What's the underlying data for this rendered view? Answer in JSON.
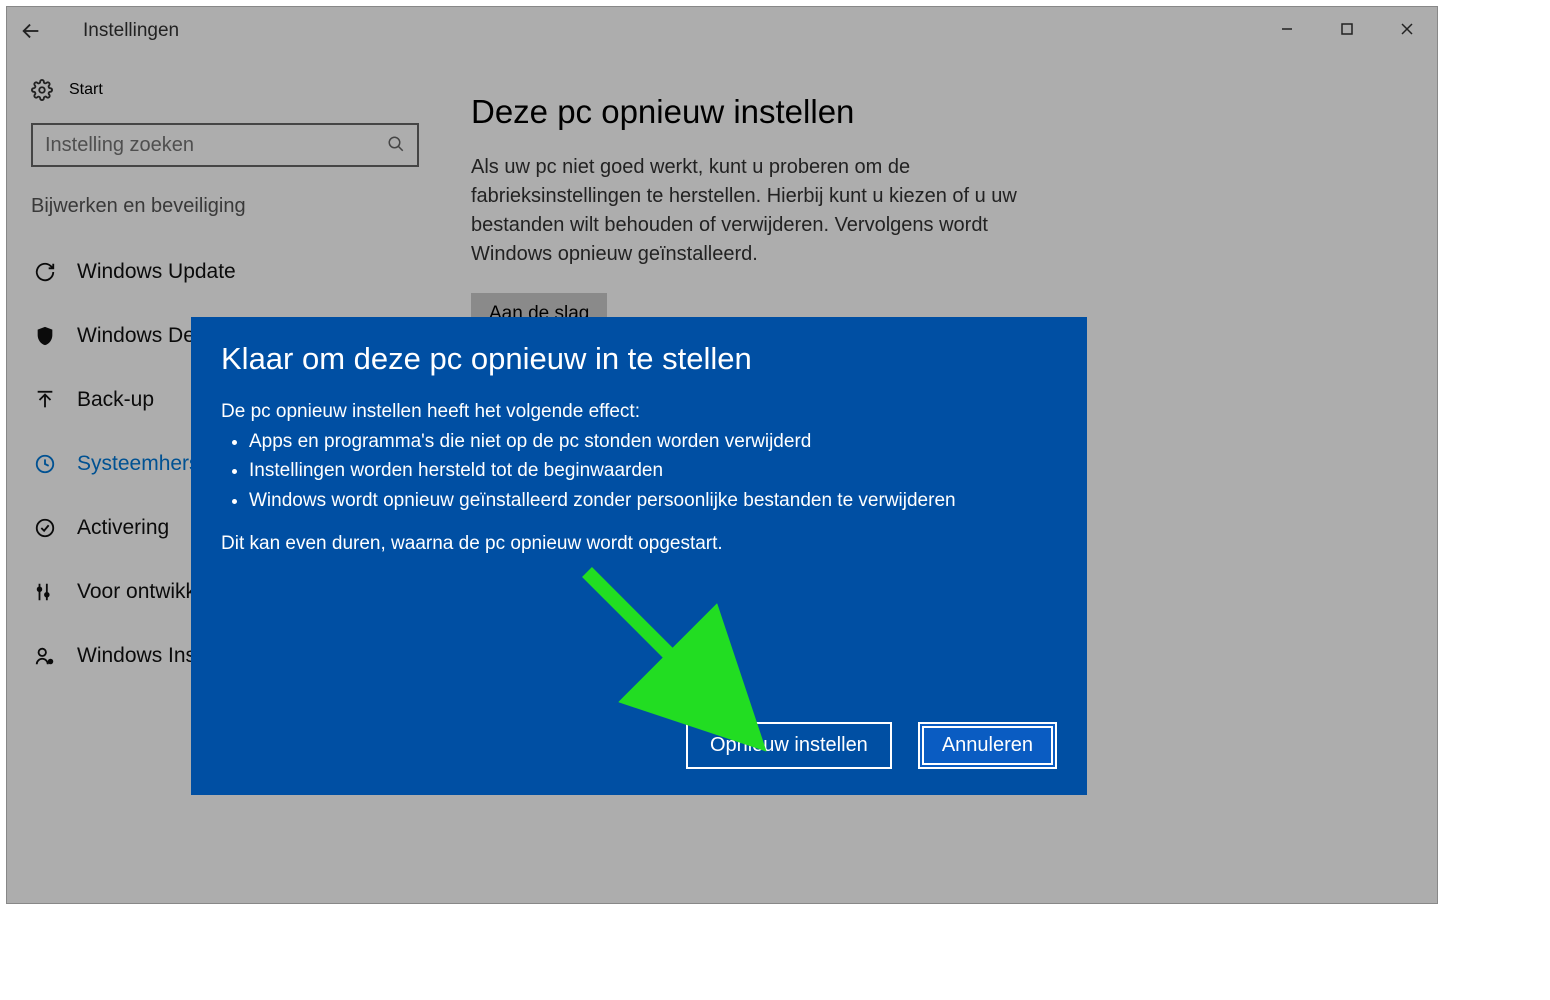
{
  "window": {
    "title": "Instellingen"
  },
  "sidebar": {
    "start_label": "Start",
    "search_placeholder": "Instelling zoeken",
    "section_label": "Bijwerken en beveiliging",
    "items": [
      {
        "label": "Windows Update",
        "icon": "sync-icon",
        "active": false
      },
      {
        "label": "Windows Defender",
        "icon": "shield-icon",
        "active": false
      },
      {
        "label": "Back-up",
        "icon": "upload-icon",
        "active": false
      },
      {
        "label": "Systeemherstel",
        "icon": "history-icon",
        "active": true
      },
      {
        "label": "Activering",
        "icon": "check-circle-icon",
        "active": false
      },
      {
        "label": "Voor ontwikkelaars",
        "icon": "sliders-icon",
        "active": false
      },
      {
        "label": "Windows Insider-programma",
        "icon": "insider-icon",
        "active": false
      }
    ]
  },
  "main": {
    "heading": "Deze pc opnieuw instellen",
    "paragraph": "Als uw pc niet goed werkt, kunt u proberen om de fabrieksinstellingen te herstellen. Hierbij kunt u kiezen of u uw bestanden wilt behouden of verwijderen. Vervolgens wordt Windows opnieuw geïnstalleerd.",
    "start_button": "Aan de slag"
  },
  "dialog": {
    "title": "Klaar om deze pc opnieuw in te stellen",
    "lead": "De pc opnieuw instellen heeft het volgende effect:",
    "bullets": [
      "Apps en programma's die niet op de pc stonden worden verwijderd",
      "Instellingen worden hersteld tot de beginwaarden",
      "Windows wordt opnieuw geïnstalleerd zonder persoonlijke bestanden te verwijderen"
    ],
    "note": "Dit kan even duren, waarna de pc opnieuw wordt opgestart.",
    "reset_label": "Opnieuw instellen",
    "cancel_label": "Annuleren"
  }
}
